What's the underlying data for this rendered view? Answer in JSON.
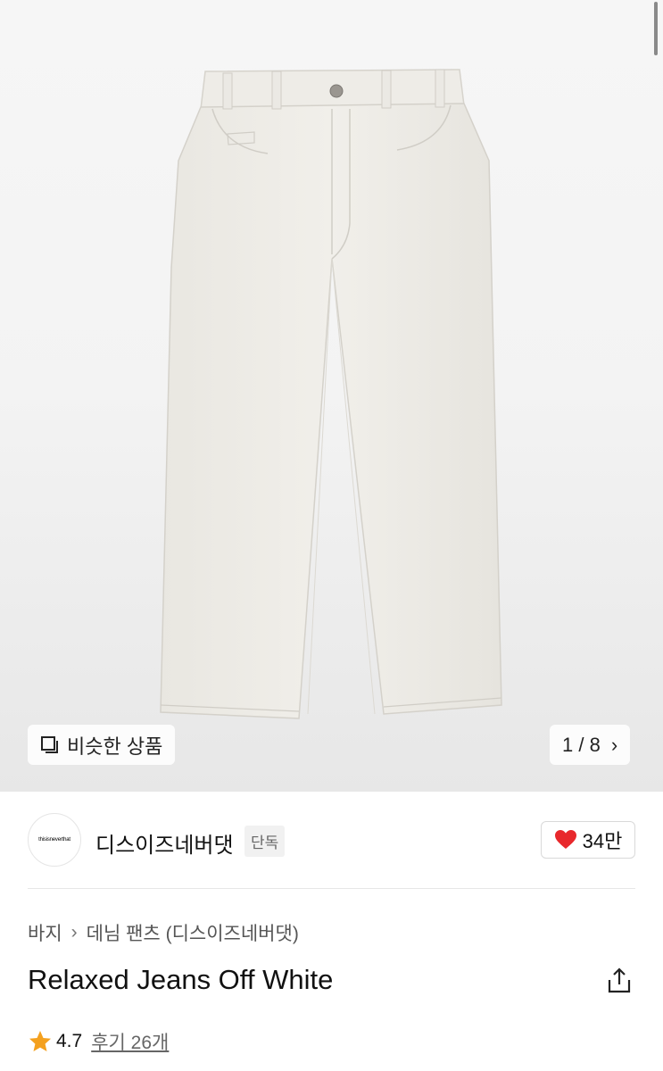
{
  "gallery": {
    "similar_label": "비슷한 상품",
    "counter": "1 / 8",
    "next_icon": "chevron-right-icon"
  },
  "brand": {
    "logo_text": "thisisneverthat",
    "name": "디스이즈네버댓",
    "badge": "단독"
  },
  "like": {
    "count": "34만",
    "icon": "heart-icon",
    "color": "#e8282c"
  },
  "breadcrumb": {
    "items": [
      "바지",
      "데님 팬츠 (디스이즈네버댓)"
    ]
  },
  "product": {
    "title": "Relaxed Jeans Off White"
  },
  "rating": {
    "value": "4.7",
    "reviews": "후기 26개",
    "star_color": "#f4a11f"
  }
}
